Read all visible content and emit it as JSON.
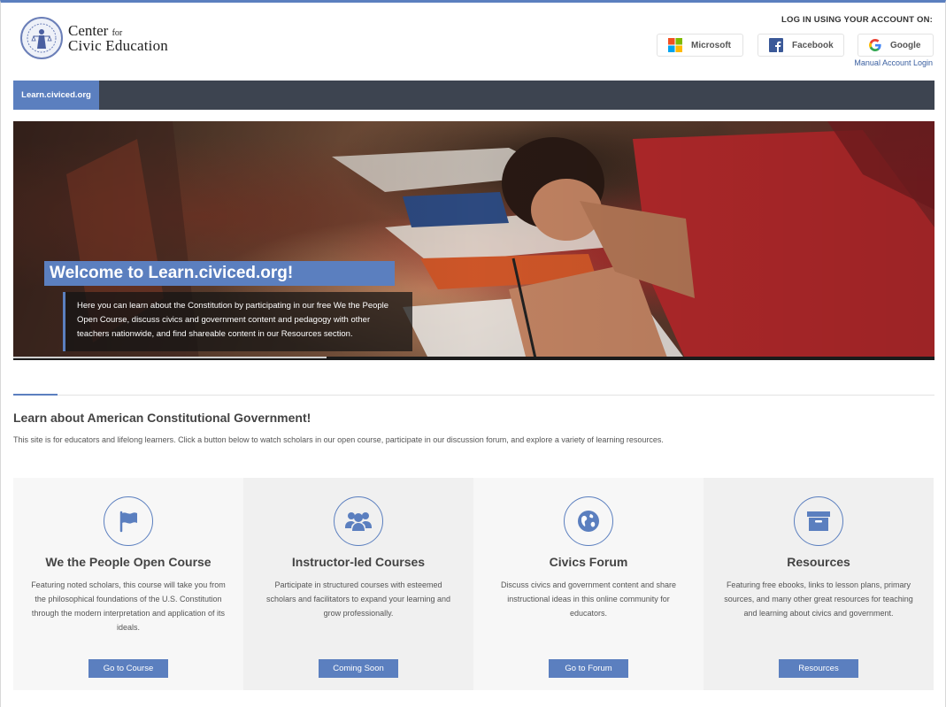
{
  "header": {
    "logo_line1": "Center",
    "logo_for": "for",
    "logo_line2": "Civic Education",
    "login_title": "LOG IN USING YOUR ACCOUNT ON:",
    "login_buttons": [
      {
        "label": "Microsoft",
        "icon": "microsoft-icon"
      },
      {
        "label": "Facebook",
        "icon": "facebook-icon"
      },
      {
        "label": "Google",
        "icon": "google-icon"
      }
    ],
    "manual_login": "Manual Account Login"
  },
  "nav": {
    "items": [
      {
        "label": "Learn.civiced.org"
      }
    ]
  },
  "hero": {
    "title": "Welcome to Learn.civiced.org!",
    "description": "Here you can learn about the Constitution by participating in our free We the People Open Course, discuss civics and government content and pedagogy with other teachers nationwide, and find shareable content in our Resources section.",
    "slide_progress": 0.34
  },
  "intro": {
    "title": "Learn about American Constitutional Government!",
    "description": "This site is for educators and lifelong learners. Click a button below to watch scholars in our open course, participate in our discussion forum, and explore a variety of learning resources."
  },
  "cards": [
    {
      "icon": "flag-icon",
      "title": "We the People Open Course",
      "description": "Featuring noted scholars, this course will take you from the philosophical foundations of the U.S. Constitution through the modern interpretation and application of its ideals.",
      "button": "Go to Course"
    },
    {
      "icon": "users-icon",
      "title": "Instructor-led Courses",
      "description": "Participate in structured courses with esteemed scholars and facilitators to expand your learning and grow professionally.",
      "button": "Coming Soon"
    },
    {
      "icon": "globe-icon",
      "title": "Civics Forum",
      "description": "Discuss civics and government content and share instructional ideas in this online community for educators.",
      "button": "Go to Forum"
    },
    {
      "icon": "archive-box-icon",
      "title": "Resources",
      "description": "Featuring free ebooks, links to lesson plans, primary sources, and many other great resources for teaching and learning about civics and government.",
      "button": "Resources"
    }
  ],
  "colors": {
    "accent": "#5b7fbf",
    "navbar": "#3d4450"
  }
}
